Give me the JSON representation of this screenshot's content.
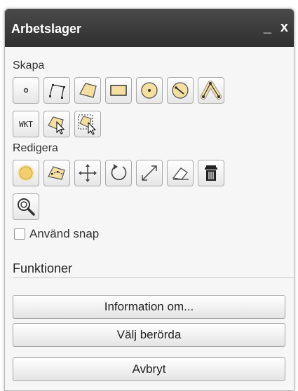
{
  "window": {
    "title": "Arbetslager",
    "minimize_label": "_",
    "close_label": "x"
  },
  "create": {
    "label": "Skapa",
    "tools": [
      "point-icon",
      "line-icon",
      "polygon-icon",
      "rectangle-icon",
      "circle-icon",
      "circle-radius-icon",
      "buffer-line-icon",
      "wkt-icon",
      "select-polygon-icon",
      "select-box-icon"
    ],
    "wkt_label": "WKT"
  },
  "edit": {
    "label": "Redigera",
    "tools": [
      "buffer-icon",
      "reshape-icon",
      "move-icon",
      "rotate-icon",
      "scale-icon",
      "eraser-icon",
      "trash-icon",
      "zoom-to-icon"
    ]
  },
  "snap": {
    "label": "Använd snap",
    "checked": false
  },
  "functions": {
    "title": "Funktioner",
    "info_button": "Information om...",
    "select_affected_button": "Välj berörda",
    "cancel_button": "Avbryt"
  },
  "colors": {
    "shape_fill": "#f5dfa0",
    "shape_stroke": "#555555",
    "titlebar": "#3a3a3a"
  }
}
